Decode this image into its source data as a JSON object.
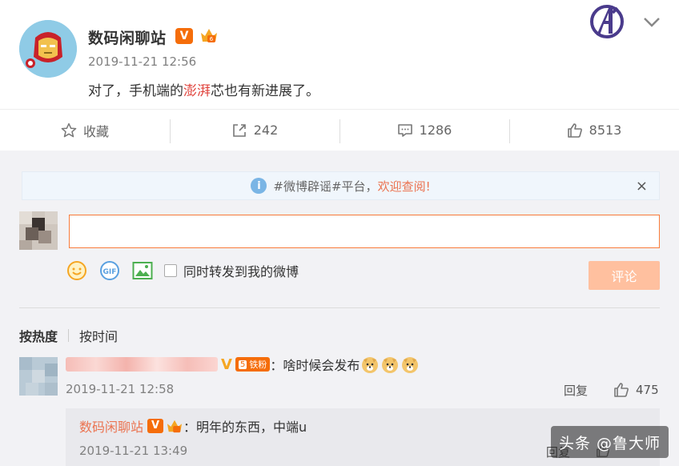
{
  "post": {
    "author": "数码闲聊站",
    "verified_badge": "V",
    "timestamp": "2019-11-21 12:56",
    "content_before": "对了，手机端的",
    "content_highlight": "澎湃",
    "content_after": "芯也有新进展了。"
  },
  "actions": {
    "favorite_label": "收藏",
    "repost_count": "242",
    "comment_count": "1286",
    "like_count": "8513"
  },
  "notice": {
    "info_glyph": "i",
    "text": "#微博辟谣#平台，",
    "link": "欢迎查阅!",
    "close_glyph": "×"
  },
  "composer": {
    "input_value": "",
    "repost_option_label": "同时转发到我的微博",
    "submit_label": "评论"
  },
  "sort": {
    "by_hot": "按热度",
    "by_time": "按时间"
  },
  "comment": {
    "verified_badge": "V",
    "fan_level": "5",
    "fan_label": "铁粉",
    "text": "：啥时候会发布",
    "timestamp": "2019-11-21 12:58",
    "reply_label": "回复",
    "like_count": "475"
  },
  "sub_comment": {
    "author": "数码闲聊站",
    "verified_badge": "V",
    "text": "：明年的东西，中端u",
    "timestamp": "2019-11-21 13:49",
    "reply_label": "回复"
  },
  "watermark": "头条 @鲁大师",
  "colors": {
    "accent_orange": "#eb7350",
    "highlight_red": "#e0423b",
    "submit_disabled": "#ffc09f",
    "verified_orange": "#f56d0a"
  }
}
